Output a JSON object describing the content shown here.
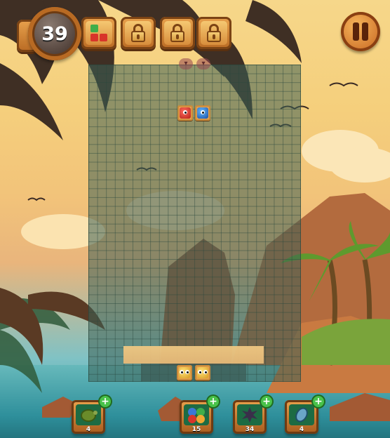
{
  "hud": {
    "score": "39",
    "slots": [
      {
        "name": "next-piece-slot",
        "icon": "mini-tiles-icon"
      },
      {
        "name": "locked-slot-1",
        "icon": "lock-icon"
      },
      {
        "name": "locked-slot-2",
        "icon": "lock-icon"
      },
      {
        "name": "locked-slot-3",
        "icon": "lock-icon"
      }
    ],
    "pause_icon": "pause-icon"
  },
  "powerups": [
    {
      "name": "turtle-powerup",
      "icon": "turtle-icon",
      "count": "4"
    },
    {
      "name": "color-bomb-powerup",
      "icon": "monster-cluster-icon",
      "count": "15"
    },
    {
      "name": "spike-bomb-powerup",
      "icon": "spike-ball-icon",
      "count": "34"
    },
    {
      "name": "gem-powerup",
      "icon": "gem-icon",
      "count": "4"
    }
  ],
  "colors": {
    "wood": "#b86a23",
    "board": "#3c6056",
    "tile_red": "#d8352a",
    "tile_blue": "#2c6bd0",
    "tile_gold": "#f0c040",
    "plus_green": "#48c24a"
  }
}
